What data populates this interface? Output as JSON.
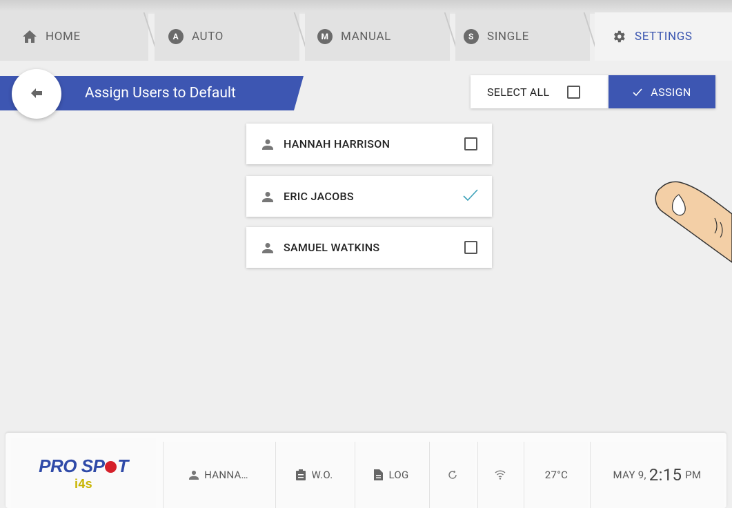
{
  "tabs": [
    {
      "label": "HOME",
      "icon": "home-icon"
    },
    {
      "label": "AUTO",
      "icon": "auto-icon",
      "badge": "A"
    },
    {
      "label": "MANUAL",
      "icon": "manual-icon",
      "badge": "M"
    },
    {
      "label": "SINGLE",
      "icon": "single-icon",
      "badge": "S"
    },
    {
      "label": "SETTINGS",
      "icon": "gear-icon",
      "active": true
    }
  ],
  "header": {
    "title": "Assign Users to Default",
    "select_all_label": "SELECT ALL",
    "assign_label": "ASSIGN"
  },
  "users": [
    {
      "name": "HANNAH HARRISON",
      "checked": false
    },
    {
      "name": "ERIC JACOBS",
      "checked": true
    },
    {
      "name": "SAMUEL WATKINS",
      "checked": false
    }
  ],
  "status_bar": {
    "logo_main": "PRO SP",
    "logo_main_end": "T",
    "logo_sub": "i4s",
    "user": "HANNA…",
    "work_order": "W.O.",
    "log": "LOG",
    "temperature": "27°C",
    "date": "MAY 9,",
    "time": "2:15",
    "ampm": "PM"
  },
  "colors": {
    "accent": "#3d56b2",
    "check": "#3aa0b8",
    "background": "#efefef"
  }
}
